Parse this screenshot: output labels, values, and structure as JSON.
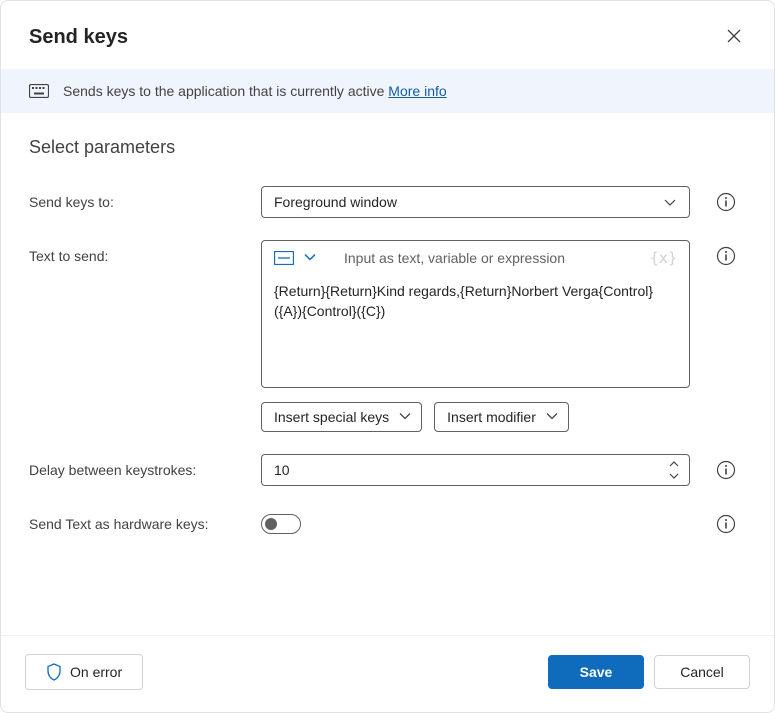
{
  "header": {
    "title": "Send keys"
  },
  "banner": {
    "text": "Sends keys to the application that is currently active",
    "more_info_label": "More info"
  },
  "section": {
    "title": "Select parameters"
  },
  "fields": {
    "send_keys_to": {
      "label": "Send keys to:",
      "value": "Foreground window"
    },
    "text_to_send": {
      "label": "Text to send:",
      "placeholder": "Input as text, variable or expression",
      "value": "{Return}{Return}Kind regards,{Return}Norbert Verga{Control}({A}){Control}({C})"
    },
    "insert_special_keys": {
      "label": "Insert special keys"
    },
    "insert_modifier": {
      "label": "Insert modifier"
    },
    "delay": {
      "label": "Delay between keystrokes:",
      "value": "10"
    },
    "hardware_keys": {
      "label": "Send Text as hardware keys:",
      "value": false
    }
  },
  "footer": {
    "on_error": "On error",
    "save": "Save",
    "cancel": "Cancel"
  }
}
